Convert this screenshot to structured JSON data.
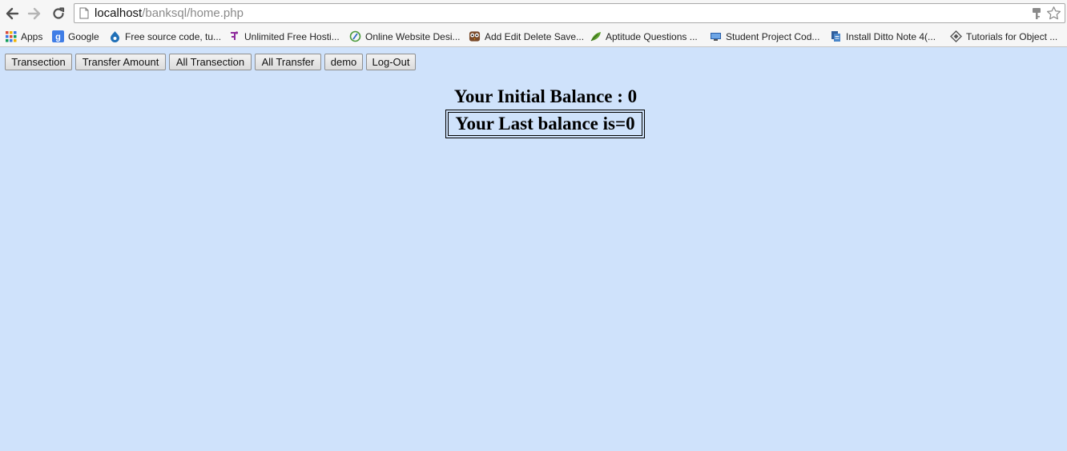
{
  "browser": {
    "url": {
      "host": "localhost",
      "path": "/banksql/home.php"
    },
    "icons": {
      "back": "arrow-left-icon",
      "forward": "arrow-right-icon",
      "reload": "reload-icon",
      "page": "page-icon",
      "key": "key-icon",
      "star": "star-icon"
    }
  },
  "bookmarks": [
    {
      "label": "Apps",
      "icon": "apps-grid-icon"
    },
    {
      "label": "Google",
      "icon": "google-icon"
    },
    {
      "label": "Free source code, tu...",
      "icon": "drupal-icon"
    },
    {
      "label": "Unlimited Free Hosti...",
      "icon": "hosting-icon"
    },
    {
      "label": "Online Website Desi...",
      "icon": "website-icon"
    },
    {
      "label": "Add Edit Delete Save...",
      "icon": "owl-icon"
    },
    {
      "label": "Aptitude Questions ...",
      "icon": "leaf-icon"
    },
    {
      "label": "Student Project Cod...",
      "icon": "monitor-icon"
    },
    {
      "label": "Install Ditto Note 4(...",
      "icon": "document-icon"
    },
    {
      "label": "Tutorials for Object ...",
      "icon": "diamond-icon"
    }
  ],
  "nav": {
    "transection": "Transection",
    "transfer_amount": "Transfer Amount",
    "all_transection": "All Transection",
    "all_transfer": "All Transfer",
    "demo": "demo",
    "logout": "Log-Out"
  },
  "balance": {
    "initial": "Your Initial Balance : 0",
    "last": "Your Last balance is=0"
  },
  "colors": {
    "page_background": "#cfe2fb",
    "chrome_background": "#f6f6f6"
  }
}
